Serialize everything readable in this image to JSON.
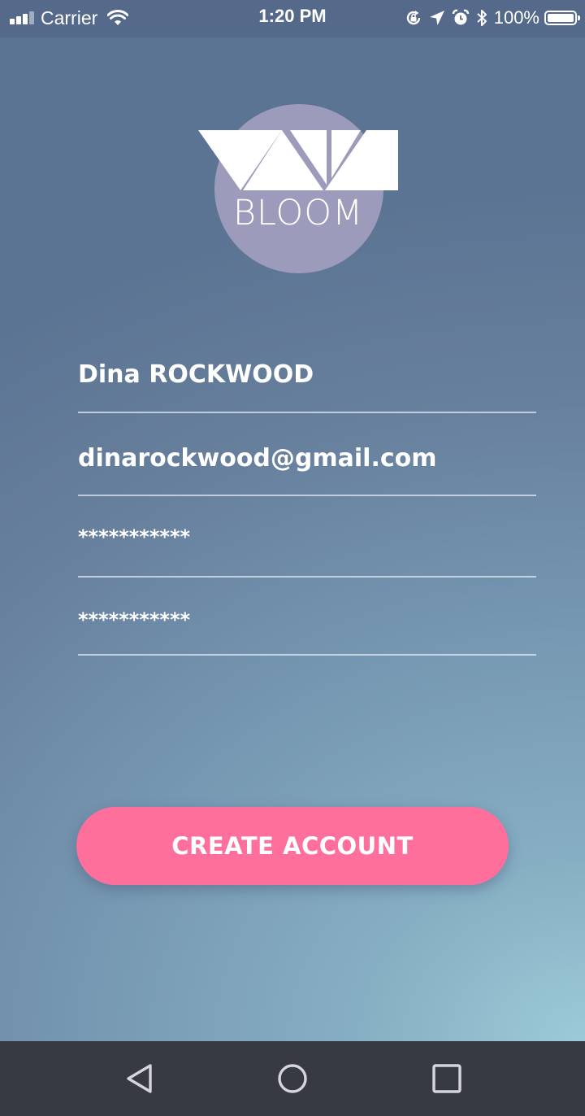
{
  "status_bar": {
    "carrier": "Carrier",
    "time": "1:20 PM",
    "battery_percent": "100%",
    "battery_level": 1.0,
    "icons": [
      "signal-icon",
      "wifi-icon",
      "orientation-lock-icon",
      "location-icon",
      "alarm-icon",
      "bluetooth-icon",
      "battery-icon"
    ]
  },
  "logo": {
    "text": "BLOOM",
    "circle_color": "#9c9bbc",
    "triangle_color": "#ffffff"
  },
  "form": {
    "name_value": "Dina ROCKWOOD",
    "email_value": "dinarockwood@gmail.com",
    "password_value": "***********",
    "confirm_password_value": "***********"
  },
  "create_button": {
    "label": "CREATE ACCOUNT",
    "color": "#ff6f9c"
  },
  "nav_bar": {
    "icons": [
      "back-icon",
      "home-icon",
      "recent-apps-icon"
    ],
    "color": "#373943"
  }
}
